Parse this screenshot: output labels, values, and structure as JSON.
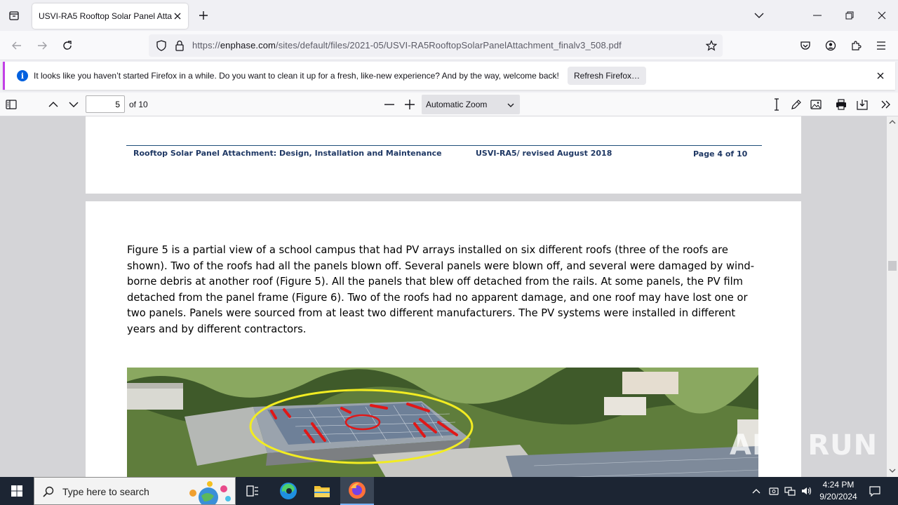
{
  "browser": {
    "tab_title": "USVI-RA5 Rooftop Solar Panel Attac",
    "url_prefix": "https://",
    "url_domain": "enphase.com",
    "url_path": "/sites/default/files/2021-05/USVI-RA5RooftopSolarPanelAttachment_finalv3_508.pdf"
  },
  "notification": {
    "message": "It looks like you haven’t started Firefox in a while. Do you want to clean it up for a fresh, like-new experience? And by the way, welcome back!",
    "button_label": "Refresh Firefox…"
  },
  "pdf_toolbar": {
    "page_number": "5",
    "page_count": "of 10",
    "zoom": "Automatic Zoom"
  },
  "document": {
    "header_left": "Rooftop Solar Panel Attachment: Design, Installation and Maintenance",
    "header_center": "USVI-RA5/ revised August 2018",
    "header_right": "Page 4 of 10",
    "paragraph": "Figure 5 is a partial view of a school campus that had PV arrays installed on six different roofs (three of the roofs are shown). Two of the roofs had all the panels blown off. Several panels were blown off, and several were damaged by wind-borne debris at another roof (Figure 5). All the panels that blew off detached from the rails. At some panels, the PV film detached from the panel frame (Figure 6). Two of the roofs had no apparent damage, and one roof may have lost one or two panels. Panels were sourced from at least two different manufacturers. The PV systems were installed in different years and by different contractors."
  },
  "taskbar": {
    "search_placeholder": "Type here to search",
    "time": "4:24 PM",
    "date": "9/20/2024"
  },
  "watermark": "ANY RUN"
}
